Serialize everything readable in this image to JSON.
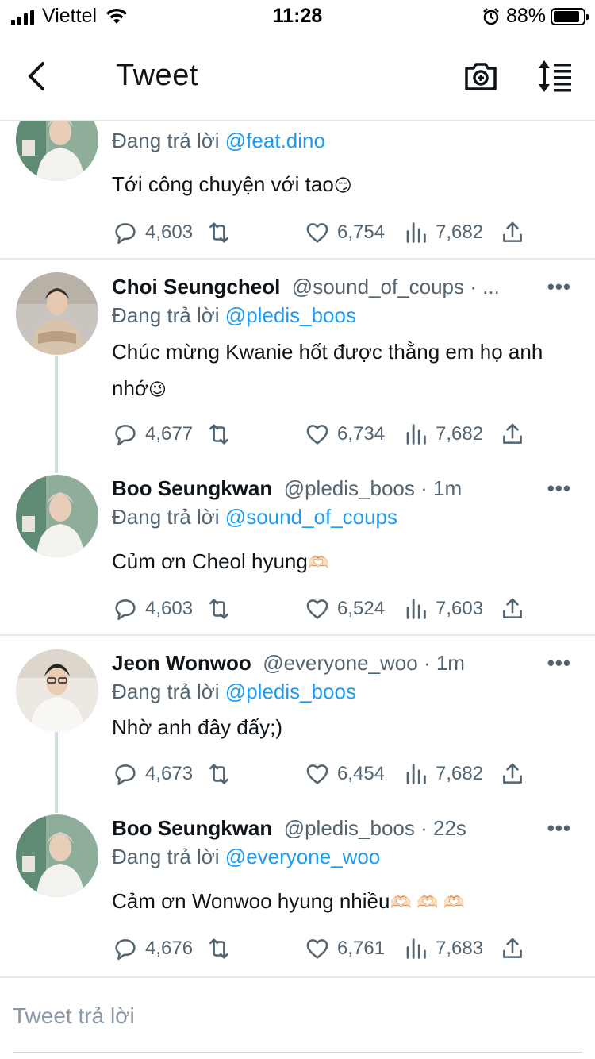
{
  "status_bar": {
    "carrier": "Viettel",
    "time": "11:28",
    "battery_pct": "88%",
    "battery_level": 0.88
  },
  "header": {
    "title": "Tweet"
  },
  "tweets": [
    {
      "name": "",
      "handle": "",
      "time": "",
      "reply_prefix": "Đang trả lời",
      "reply_to": "@feat.dino",
      "text": "Tới công chuyện với tao",
      "emoji": "😏",
      "replies": "4,603",
      "likes": "6,754",
      "views": "7,682"
    },
    {
      "name": "Choi Seungcheol",
      "handle": "@sound_of_coups",
      "time": "· ...",
      "reply_prefix": "Đang trả lời",
      "reply_to": "@pledis_boos",
      "text": "Chúc mừng Kwanie hốt được thằng em họ anh nhớ",
      "emoji": "😉",
      "replies": "4,677",
      "likes": "6,734",
      "views": "7,682"
    },
    {
      "name": "Boo Seungkwan",
      "handle": "@pledis_boos",
      "time": "· 1m",
      "reply_prefix": "Đang trả lời",
      "reply_to": "@sound_of_coups",
      "text": "Củm ơn Cheol hyung",
      "emoji": "🫶🏻",
      "replies": "4,603",
      "likes": "6,524",
      "views": "7,603"
    },
    {
      "name": "Jeon Wonwoo",
      "handle": "@everyone_woo",
      "time": "· 1m",
      "reply_prefix": "Đang trả lời",
      "reply_to": "@pledis_boos",
      "text": "Nhờ anh đây đấy;)",
      "emoji": "",
      "replies": "4,673",
      "likes": "6,454",
      "views": "7,682"
    },
    {
      "name": "Boo Seungkwan",
      "handle": "@pledis_boos",
      "time": "· 22s",
      "reply_prefix": "Đang trả lời",
      "reply_to": "@everyone_woo",
      "text": "Cảm ơn Wonwoo hyung nhiều",
      "emoji": "🫶🏻 🫶🏻 🫶🏻",
      "replies": "4,676",
      "likes": "6,761",
      "views": "7,683"
    }
  ],
  "composer": {
    "placeholder": "Tweet trả lời"
  },
  "colors": {
    "link": "#1d9bf0",
    "muted": "#536471",
    "text": "#0f1419",
    "divider": "#e6e9ec"
  },
  "icons": [
    "back-arrow-icon",
    "camera-plus-icon",
    "sort-icon",
    "reply-icon",
    "retweet-icon",
    "like-icon",
    "views-icon",
    "share-icon",
    "more-icon"
  ]
}
